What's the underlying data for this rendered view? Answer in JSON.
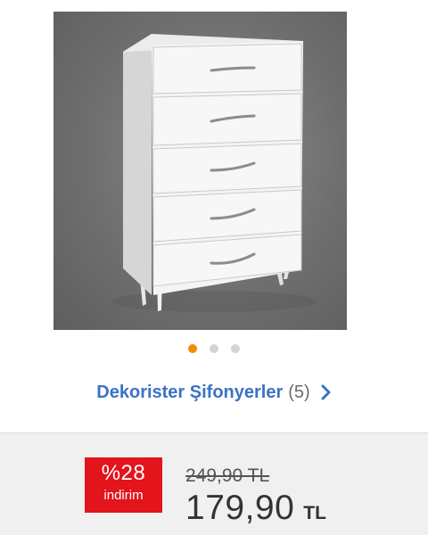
{
  "product": {
    "image_alt": "Beyaz şifonyer",
    "carousel": {
      "total": 3,
      "active_index": 0
    }
  },
  "store": {
    "name": "Dekorister Şifonyerler",
    "count": "(5)"
  },
  "pricing": {
    "discount_percent": "%28",
    "discount_label": "indirim",
    "old_price": "249,90 TL",
    "new_price": "179,90",
    "currency": "TL"
  },
  "colors": {
    "accent_orange": "#f28b00",
    "link_blue": "#3a73c4",
    "discount_red": "#e3141b"
  },
  "icons": {
    "store_arrow": "chevron-right-icon"
  }
}
